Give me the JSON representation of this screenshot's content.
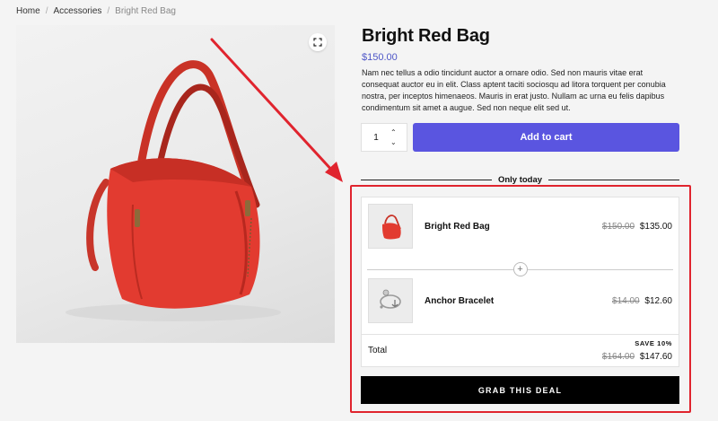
{
  "breadcrumb": {
    "home": "Home",
    "category": "Accessories",
    "current": "Bright Red Bag",
    "separator": "/"
  },
  "product": {
    "title": "Bright Red Bag",
    "price": "$150.00",
    "description": "Nam nec tellus a odio tincidunt auctor a ornare odio. Sed non mauris vitae erat consequat auctor eu in elit. Class aptent taciti sociosqu ad litora torquent per conubia nostra, per inceptos himenaeos. Mauris in erat justo. Nullam ac urna eu felis dapibus condimentum sit amet a augue. Sed non neque elit sed ut.",
    "quantity": "1",
    "add_to_cart": "Add to cart",
    "zoom_icon": "expand-icon"
  },
  "deal": {
    "heading": "Only today",
    "items": [
      {
        "name": "Bright Red Bag",
        "old_price": "$150.00",
        "new_price": "$135.00"
      },
      {
        "name": "Anchor Bracelet",
        "old_price": "$14.00",
        "new_price": "$12.60"
      }
    ],
    "plus": "+",
    "total_label": "Total",
    "save_label": "SAVE 10%",
    "total_old": "$164.00",
    "total_new": "$147.60",
    "cta": "GRAB THIS DEAL"
  },
  "colors": {
    "accent": "#5a55e0",
    "price": "#4e56c7",
    "highlight_frame": "#e0242e"
  }
}
